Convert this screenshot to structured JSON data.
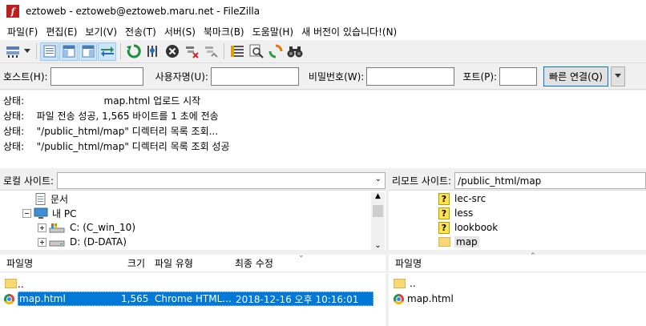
{
  "title": {
    "app_icon": "filezilla-icon",
    "text": "eztoweb - eztoweb@eztoweb.maru.net - FileZilla"
  },
  "menu": [
    "파일(F)",
    "편집(E)",
    "보기(V)",
    "전송(T)",
    "서버(S)",
    "북마크(B)",
    "도움말(H)",
    "새 버전이 있습니다!(N)"
  ],
  "toolbar": {
    "icons": [
      "site-manager-icon",
      "dropdown-arrow-icon",
      "toggle-log-icon",
      "toggle-local-tree-icon",
      "toggle-remote-tree-icon",
      "toggle-queue-icon",
      "refresh-icon",
      "process-queue-icon",
      "cancel-icon",
      "disconnect-icon",
      "reconnect-icon",
      "directory-listing-filter-icon",
      "toggle-comparison-icon",
      "sync-browsing-icon",
      "search-binoculars-icon"
    ]
  },
  "quickconnect": {
    "host_label": "호스트(H):",
    "user_label": "사용자명(U):",
    "pass_label": "비밀번호(W):",
    "port_label": "포트(P):",
    "host_value": "",
    "user_value": "",
    "pass_value": "",
    "port_value": "",
    "connect_label": "빠른 연결(Q)"
  },
  "log": [
    {
      "label": "상태:",
      "message": "                        map.html 업로드 시작"
    },
    {
      "label": "상태:",
      "message": "  파일 전송 성공, 1,565 바이트를 1 초에 전송"
    },
    {
      "label": "상태:",
      "message": "  \"/public_html/map\" 디렉터리 목록 조회..."
    },
    {
      "label": "상태:",
      "message": "  \"/public_html/map\" 디렉터리 목록 조회 성공"
    }
  ],
  "local": {
    "site_label": "로컬 사이트:",
    "site_value": "",
    "tree": [
      {
        "label": "문서",
        "icon": "documents-icon"
      },
      {
        "label": "내 PC",
        "icon": "computer-icon"
      },
      {
        "label": "C: (C_win_10)",
        "icon": "drive-icon"
      },
      {
        "label": "D: (D-DATA)",
        "icon": "drive-icon"
      }
    ],
    "columns": [
      "파일명",
      "크기",
      "파일 유형",
      "최종 수정"
    ],
    "files": [
      {
        "name": "..",
        "size": "",
        "type": "",
        "modified": ""
      },
      {
        "name": "map.html",
        "size": "1,565",
        "type": "Chrome HTML...",
        "modified": "2018-12-16 오후 10:16:01"
      }
    ]
  },
  "remote": {
    "site_label": "리모트 사이트:",
    "site_value": "/public_html/map",
    "tree": [
      {
        "label": "lec-src",
        "icon": "unknown-folder-icon"
      },
      {
        "label": "less",
        "icon": "unknown-folder-icon"
      },
      {
        "label": "lookbook",
        "icon": "unknown-folder-icon"
      },
      {
        "label": "map",
        "icon": "folder-icon"
      }
    ],
    "columns": [
      "파일명"
    ],
    "files": [
      {
        "name": ".."
      },
      {
        "name": "map.html"
      }
    ]
  }
}
